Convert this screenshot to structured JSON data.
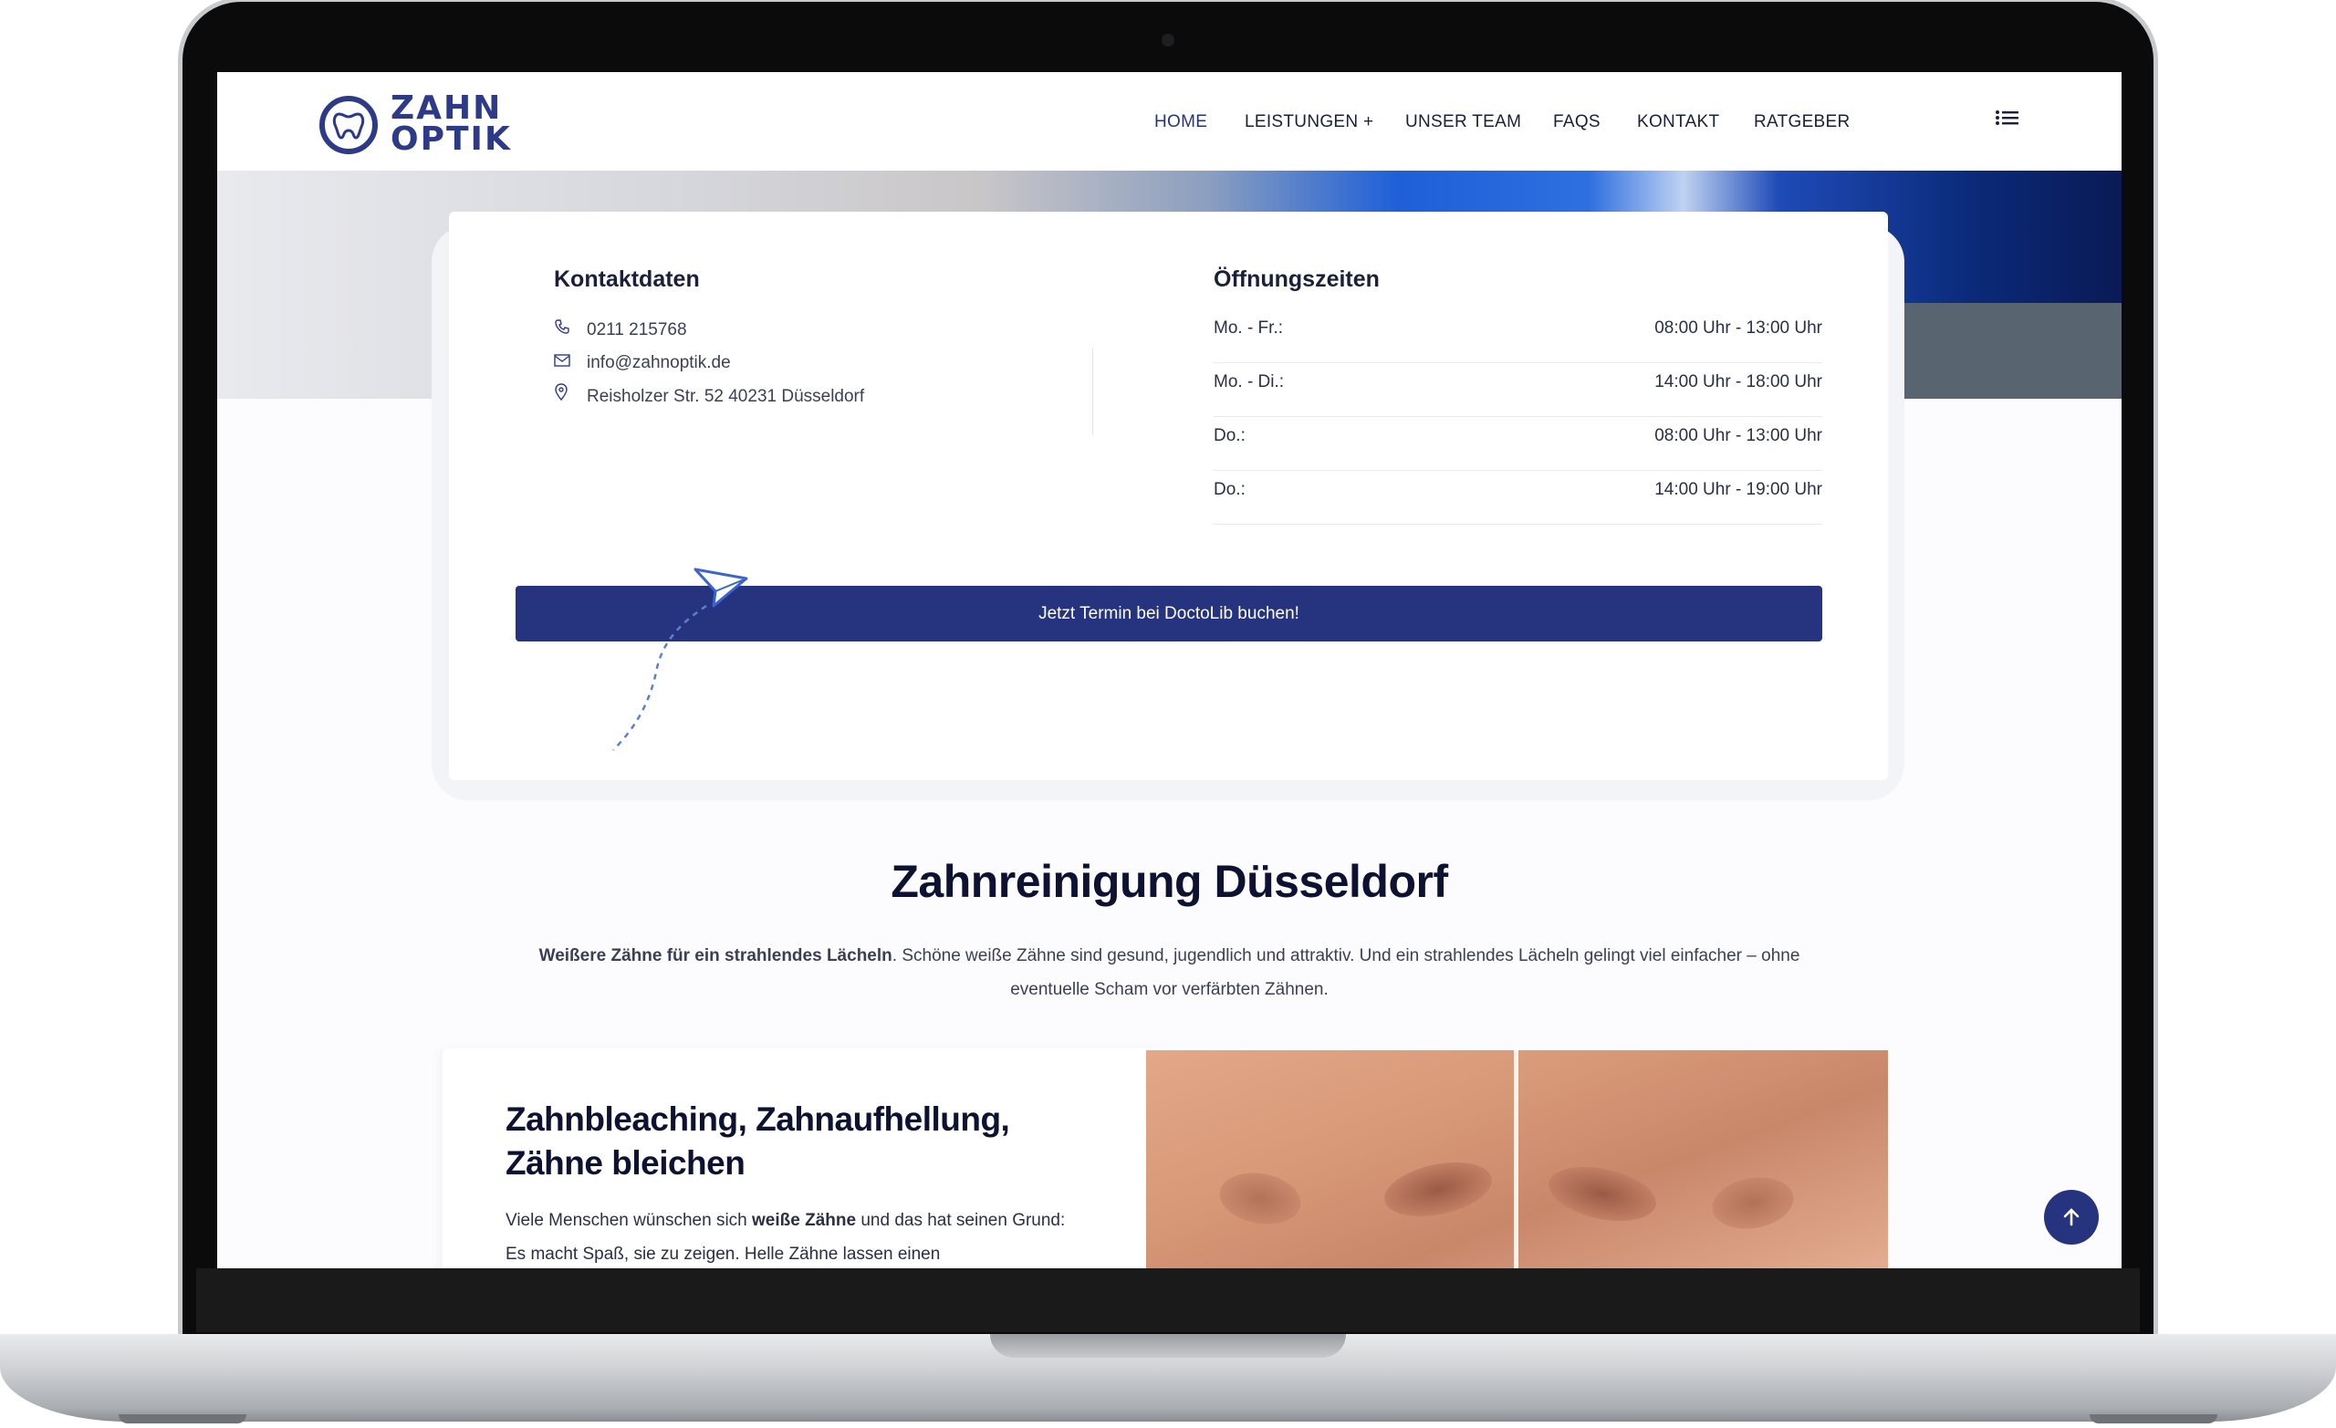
{
  "nav": {
    "logo_line1": "ZAHN",
    "logo_line2": "OPTIK",
    "items": [
      {
        "label": "HOME"
      },
      {
        "label": "LEISTUNGEN +"
      },
      {
        "label": "UNSER TEAM"
      },
      {
        "label": "FAQS"
      },
      {
        "label": "KONTAKT"
      },
      {
        "label": "RATGEBER"
      }
    ],
    "menu_icon": "list-menu-icon"
  },
  "contact": {
    "heading": "Kontaktdaten",
    "phone": "0211 215768",
    "email": "info@zahnoptik.de",
    "address": "Reisholzer Str. 52 40231 Düsseldorf"
  },
  "hours": {
    "heading": "Öffnungszeiten",
    "rows": [
      {
        "day": "Mo. - Fr.:",
        "time": "08:00 Uhr - 13:00 Uhr"
      },
      {
        "day": "Mo. - Di.:",
        "time": "14:00 Uhr - 18:00 Uhr"
      },
      {
        "day": "Do.:",
        "time": "08:00 Uhr - 13:00 Uhr"
      },
      {
        "day": "Do.:",
        "time": "14:00 Uhr - 19:00 Uhr"
      }
    ]
  },
  "book_button": "Jetzt Termin bei DoctoLib buchen!",
  "main": {
    "title": "Zahnreinigung Düsseldorf",
    "intro_bold": "Weißere Zähne für ein strahlendes Lächeln",
    "intro_rest": ". Schöne weiße Zähne sind gesund, jugendlich und attraktiv. Und ein strahlendes Lächeln gelingt viel einfacher – ohne eventuelle Scham vor verfärbten Zähnen.",
    "sub_title": "Zahnbleaching, Zahnaufhellung, Zähne bleichen",
    "body_pre": "Viele Menschen wünschen sich ",
    "body_bold": "weiße Zähne",
    "body_post": " und das hat seinen Grund: Es macht Spaß, sie zu zeigen. Helle Zähne lassen einen"
  },
  "scroll_top_icon": "arrow-up-icon",
  "colors": {
    "brand": "#26347f",
    "text_dark": "#0e1232"
  }
}
